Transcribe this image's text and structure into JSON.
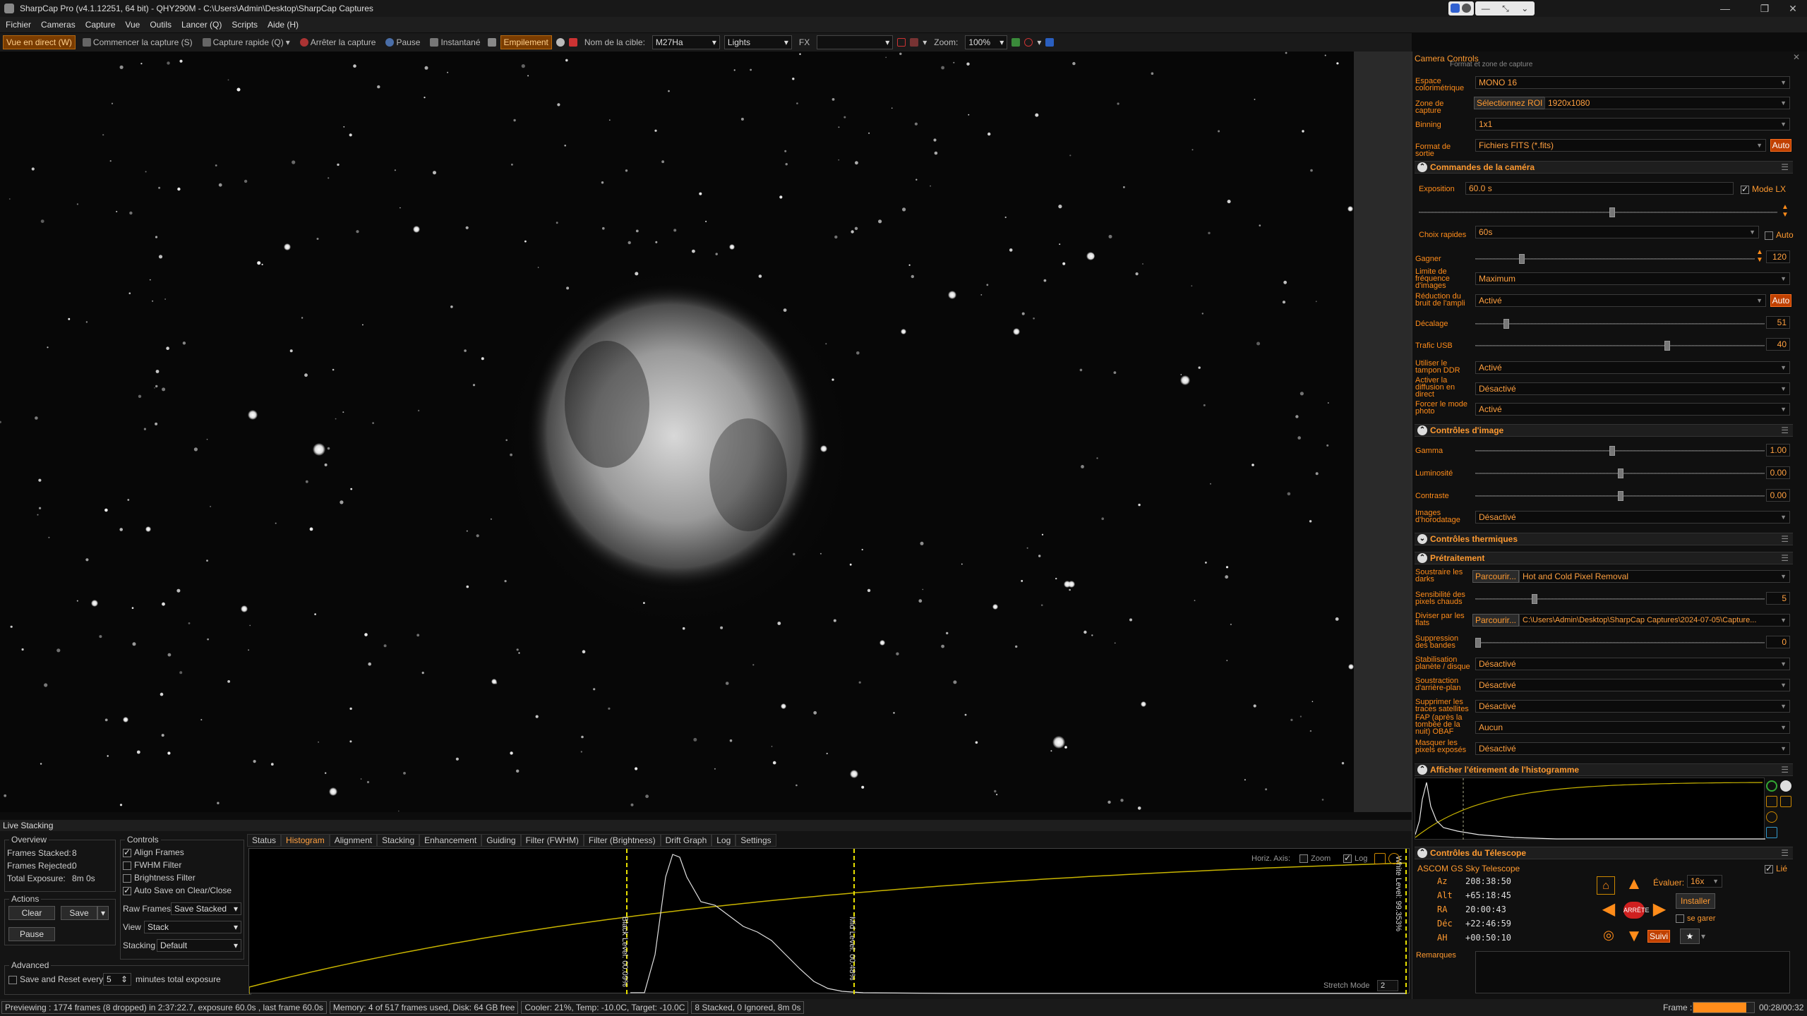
{
  "window": {
    "title": "SharpCap Pro (v4.1.12251, 64 bit) - QHY290M - C:\\Users\\Admin\\Desktop\\SharpCap Captures"
  },
  "menu": [
    "Fichier",
    "Cameras",
    "Capture",
    "Vue",
    "Outils",
    "Lancer (Q)",
    "Scripts",
    "Aide (H)"
  ],
  "toolbar": {
    "live_view": "Vue en direct (W)",
    "start_capture": "Commencer la capture (S)",
    "quick_capture": "Capture rapide (Q)",
    "stop_capture": "Arrêter la capture",
    "pause": "Pause",
    "snapshot": "Instantané",
    "stacking": "Empilement",
    "target_label": "Nom de la cible:",
    "target_value": "M27Ha",
    "frame_type": "Lights",
    "fx_label": "FX",
    "zoom_label": "Zoom:",
    "zoom_value": "100%"
  },
  "live_stacking": {
    "header": "Live Stacking",
    "overview_title": "Overview",
    "frames_stacked_label": "Frames Stacked:",
    "frames_stacked": "8",
    "frames_rejected_label": "Frames Rejected:",
    "frames_rejected": "0",
    "total_exposure_label": "Total Exposure:",
    "total_exposure": "8m 0s",
    "actions_title": "Actions",
    "clear": "Clear",
    "save": "Save",
    "pause": "Pause",
    "advanced_title": "Advanced",
    "save_reset_label": "Save and Reset every",
    "save_reset_value": "5",
    "save_reset_suffix": "minutes total exposure",
    "controls_title": "Controls",
    "align_frames": "Align Frames",
    "fwhm_filter": "FWHM Filter",
    "brightness_filter": "Brightness Filter",
    "auto_save": "Auto Save on Clear/Close",
    "raw_frames_label": "Raw Frames",
    "raw_frames_value": "Save Stacked",
    "view_label": "View",
    "view_value": "Stack",
    "stacking_label": "Stacking",
    "stacking_value": "Default",
    "tabs": [
      "Status",
      "Histogram",
      "Alignment",
      "Stacking",
      "Enhancement",
      "Guiding",
      "Filter (FWHM)",
      "Filter (Brightness)",
      "Drift Graph",
      "Log",
      "Settings"
    ],
    "hist_axis_label": "Horiz. Axis:",
    "hist_zoom": "Zoom",
    "hist_log": "Log",
    "black_level": "Black Level: 00.09%",
    "mid_level": "Mid Level: 00.48%",
    "white_level": "White Level: 99.353%",
    "stretch_mode": "Stretch Mode",
    "stretch_value": "2"
  },
  "statusbar": {
    "preview": "Previewing : 1774 frames (8 dropped) in 2:37:22.7, exposure 60.0s , last frame 60.0s",
    "memory": "Memory: 4 of 517 frames used, Disk: 64 GB free",
    "cooler": "Cooler: 21%, Temp: -10.0C, Target: -10.0C",
    "stacked": "8 Stacked, 0 Ignored, 8m 0s",
    "frame_label": "Frame :",
    "frame_time": "00:28/00:32"
  },
  "panel": {
    "title": "Camera Controls",
    "capture_format_header": "Format et zone de capture",
    "color_space_label": "Espace colorimétrique",
    "color_space": "MONO 16",
    "capture_area_label": "Zone de capture",
    "roi_button": "Sélectionnez ROI",
    "capture_area": "1920x1080",
    "binning_label": "Binning",
    "binning": "1x1",
    "output_format_label": "Format de sortie",
    "output_format": "Fichiers FITS (*.fits)",
    "auto": "Auto",
    "camera_header": "Commandes de la caméra",
    "exposure_label": "Exposition",
    "exposure": "60.0 s",
    "lx_mode": "Mode LX",
    "quick_choices_label": "Choix rapides",
    "quick_choices": "60s",
    "auto_check": "Auto",
    "gain_label": "Gagner",
    "gain": "120",
    "frame_rate_label": "Limite de fréquence d'images",
    "frame_rate": "Maximum",
    "amp_noise_label": "Réduction du bruit de l'ampli",
    "amp_noise": "Activé",
    "offset_label": "Décalage",
    "offset": "51",
    "usb_label": "Trafic USB",
    "usb": "40",
    "ddr_label": "Utiliser le tampon DDR",
    "ddr": "Activé",
    "live_stream_label": "Activer la diffusion en direct",
    "live_stream": "Désactivé",
    "photo_mode_label": "Forcer le mode photo",
    "photo_mode": "Activé",
    "image_header": "Contrôles d'image",
    "gamma_label": "Gamma",
    "gamma": "1.00",
    "brightness_label": "Luminosité",
    "brightness": "0.00",
    "contrast_label": "Contraste",
    "contrast": "0.00",
    "timestamp_label": "Images d'horodatage",
    "timestamp": "Désactivé",
    "thermal_header": "Contrôles thermiques",
    "preproc_header": "Prétraitement",
    "darks_label": "Soustraire les darks",
    "browse": "Parcourir...",
    "darks": "Hot and Cold Pixel Removal",
    "hot_sens_label": "Sensibilité des pixels chauds",
    "hot_sens": "5",
    "flats_label": "Diviser par les flats",
    "flats": "C:\\Users\\Admin\\Desktop\\SharpCap Captures\\2024-07-05\\Capture...",
    "banding_label": "Suppression des bandes",
    "banding": "0",
    "stab_label": "Stabilisation planète / disque",
    "stab": "Désactivé",
    "bg_label": "Soustraction d'arrière-plan",
    "bg": "Désactivé",
    "sat_label": "Supprimer les traces satellites",
    "fap_label": "FAP (après la tombée de la nuit) OBAF",
    "fap": "Désactivé",
    "sat_value": "Aucun",
    "mask_label": "Masquer les pixels exposés",
    "mask": "Désactivé",
    "hist_header": "Afficher l'étirement de l'histogramme",
    "telescope_header": "Contrôles du Télescope",
    "scope_name": "ASCOM GS Sky Telescope",
    "linked": "Lié",
    "az_label": "Az",
    "az": "208:38:50",
    "alt_label": "Alt",
    "alt": "+65:18:45",
    "ra_label": "RA",
    "ra": "20:00:43",
    "dec_label": "Déc",
    "dec": "+22:46:59",
    "ha_label": "AH",
    "ha": "+00:50:10",
    "rate_label": "Évaluer:",
    "rate": "16x",
    "install": "Installer",
    "stop": "ARRÊTE",
    "park": "se garer",
    "follow": "Suivi",
    "remarks_label": "Remarques"
  },
  "colors": {
    "accent": "#ff8c1a",
    "active_bg": "#7a3c00",
    "curve": "#c8b400",
    "level_line": "#e8e000"
  }
}
